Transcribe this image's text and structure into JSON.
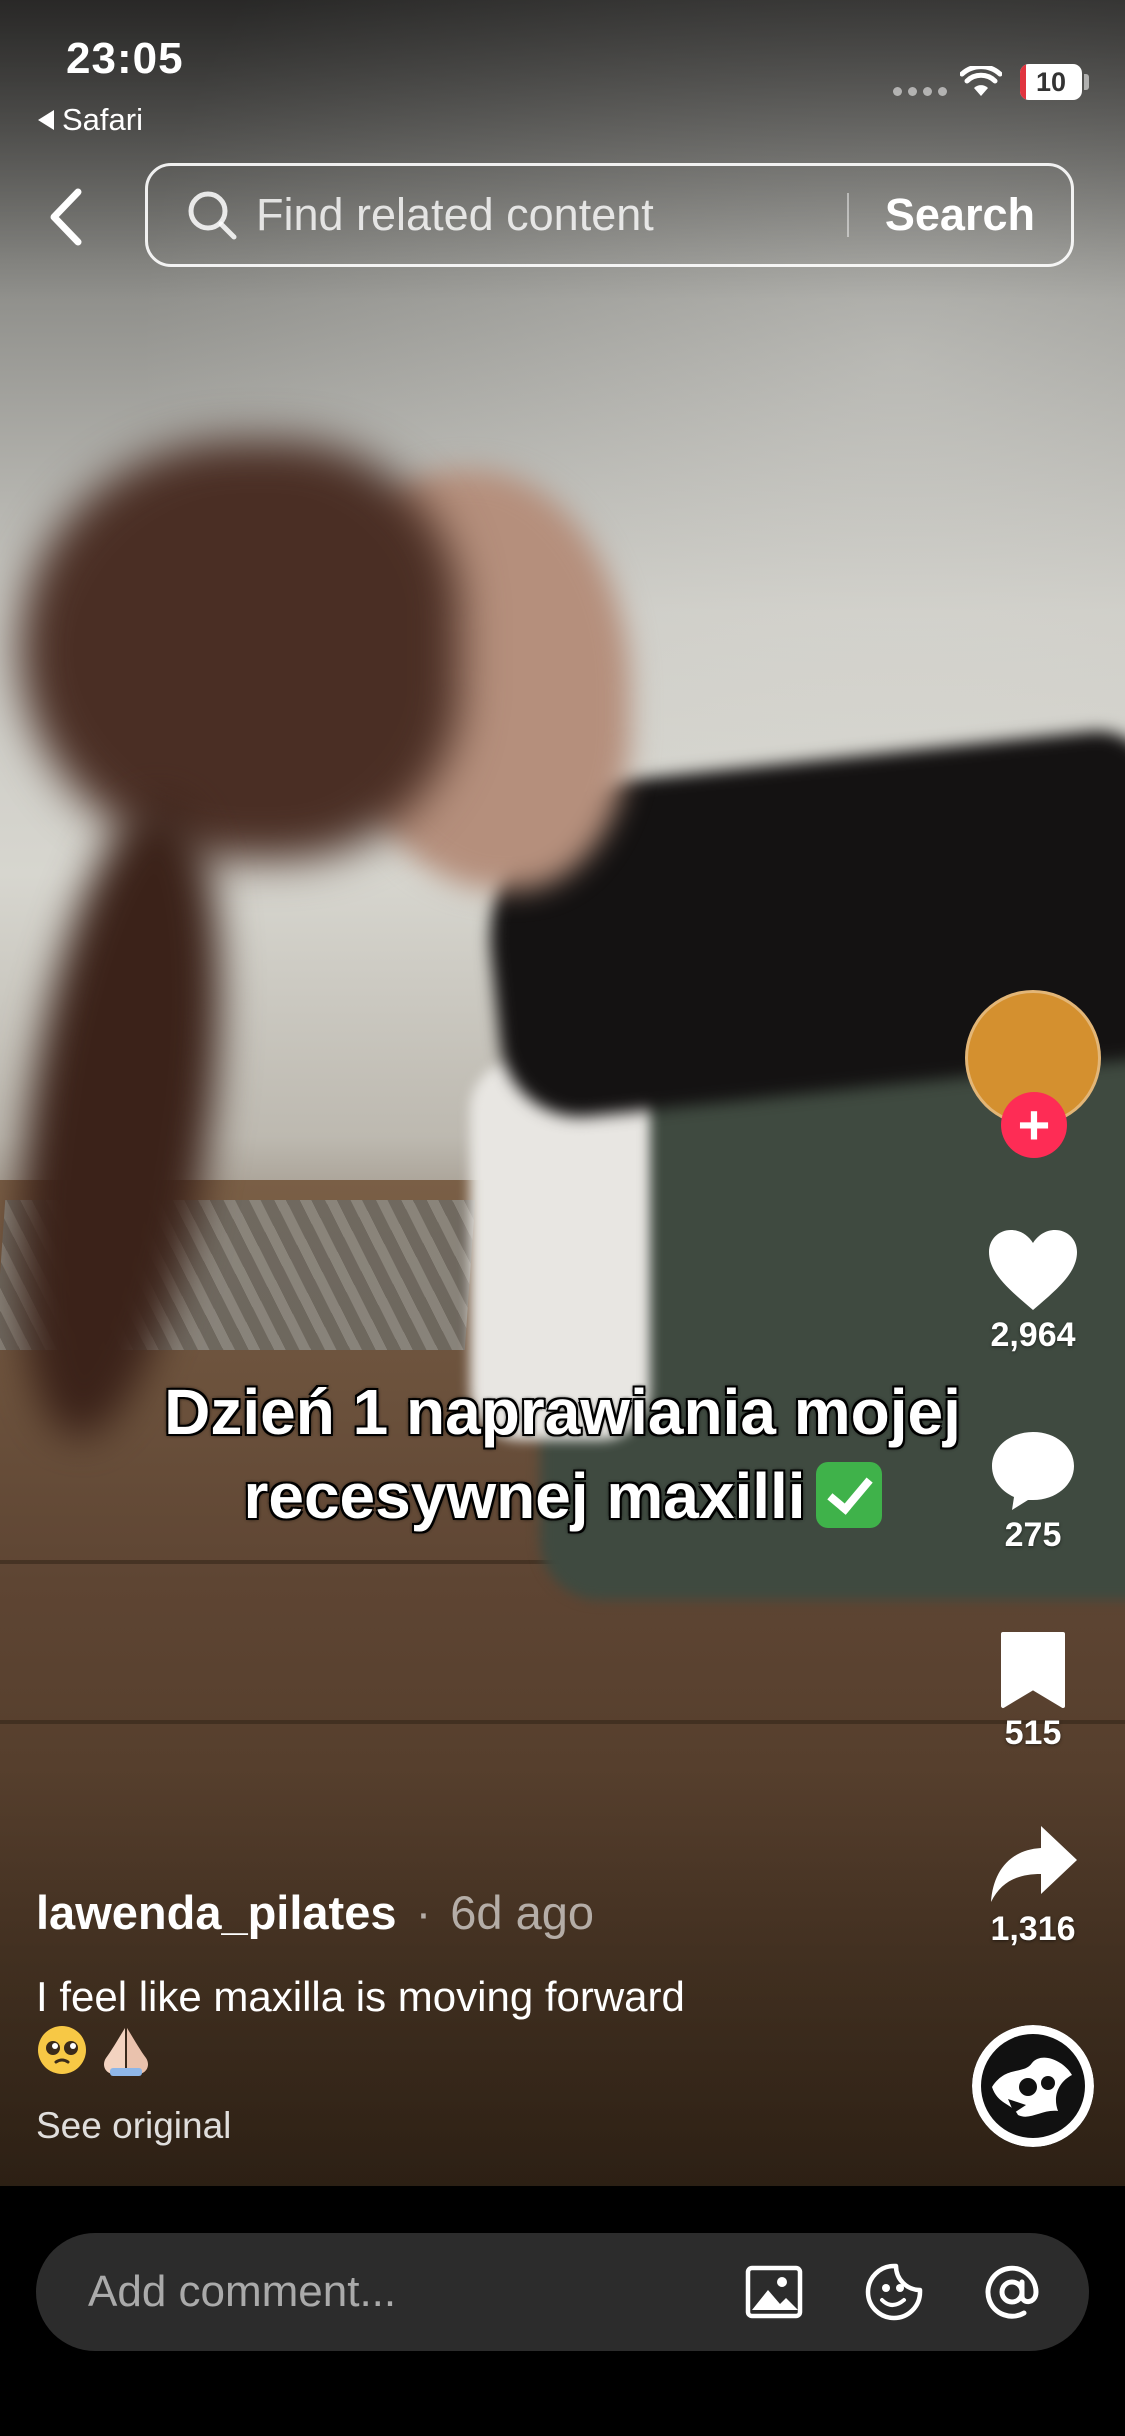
{
  "status_bar": {
    "time": "23:05",
    "back_app": "Safari",
    "battery": "10",
    "battery_level": 0.1,
    "battery_color": "#e0343f"
  },
  "header": {
    "search_placeholder": "Find related content",
    "search_button": "Search"
  },
  "video": {
    "overlay_line1": "Dzień 1 naprawiania mojej",
    "overlay_line2": "recesywnej maxilli"
  },
  "actions": {
    "likes": "2,964",
    "comments": "275",
    "saves": "515",
    "shares": "1,316"
  },
  "post": {
    "author": "lawenda_pilates",
    "separator": "·",
    "time_ago": "6d ago",
    "description": "I feel like maxilla is moving forward",
    "see_original": "See original"
  },
  "comment_bar": {
    "placeholder": "Add comment..."
  },
  "colors": {
    "accent": "#fe2c55",
    "avatar": "#d4902f"
  },
  "icons": [
    "back-chevron-icon",
    "search-icon",
    "heart-icon",
    "comment-icon",
    "bookmark-icon",
    "share-icon",
    "image-icon",
    "sticker-icon",
    "mention-icon",
    "wifi-icon",
    "check-mark-icon",
    "pleading-face-emoji",
    "folded-hands-emoji"
  ]
}
